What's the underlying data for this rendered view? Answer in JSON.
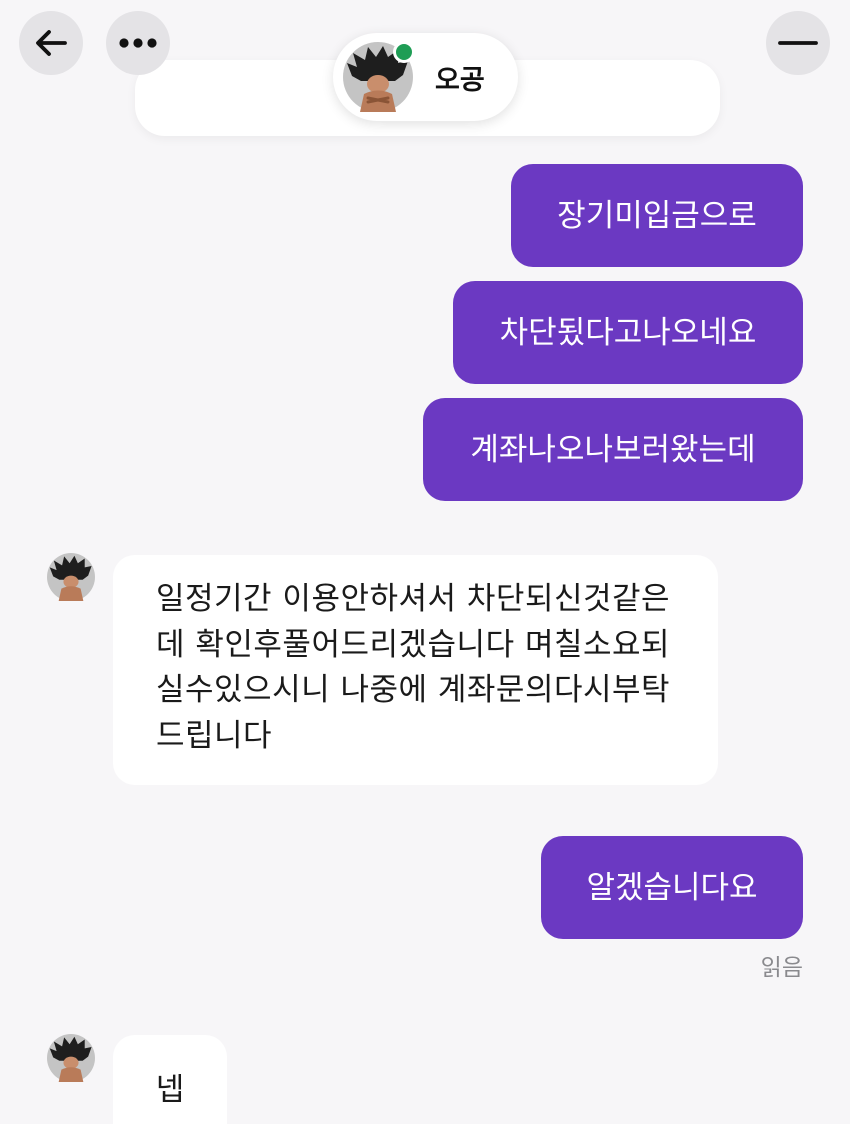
{
  "header": {
    "back_icon": "arrow-left-icon",
    "more_icon": "more-horizontal-icon",
    "minimize_icon": "minimize-icon",
    "contact_name": "오공",
    "online_status_color": "#1f9d55"
  },
  "messages": [
    {
      "direction": "sent",
      "text": "장기미입금으로"
    },
    {
      "direction": "sent",
      "text": "차단됬다고나오네요"
    },
    {
      "direction": "sent",
      "text": "계좌나오나보러왔는데"
    },
    {
      "direction": "received",
      "lines": [
        "일정기간 이용안하셔서 차단되신것같은",
        "데 확인후풀어드리겠습니다 며칠소요되",
        "실수있으시니 나중에 계좌문의다시부탁",
        "드립니다"
      ]
    },
    {
      "direction": "sent",
      "text": "알겠습니다요"
    },
    {
      "direction": "received",
      "text": "넵"
    }
  ],
  "read_receipt": "읽음",
  "colors": {
    "sent_bubble": "#6b39c2",
    "received_bubble": "#ffffff",
    "background": "#f7f6f8"
  }
}
